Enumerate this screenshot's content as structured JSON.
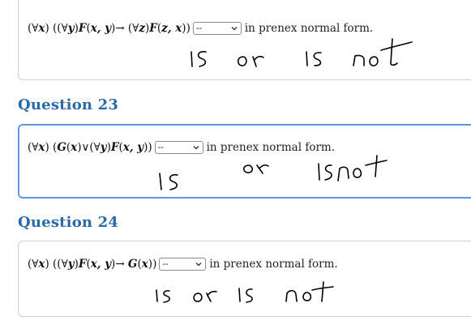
{
  "questions": [
    {
      "heading": "",
      "formula": {
        "part1": "(∀",
        "var1": "x",
        "part2": ") ((∀",
        "var2": "y",
        "part3": ")",
        "pred": "F",
        "part4": "(",
        "args": "x, y",
        "part5": ")→ (∀",
        "var3": "z",
        "part6": ")",
        "pred2": "F",
        "part7": "(",
        "args2": "z, x",
        "part8": "))"
      },
      "select_value": "--",
      "suffix": "in prenex normal form.",
      "handwriting": [
        "is",
        "or",
        "is not"
      ]
    },
    {
      "heading": "Question 23",
      "formula": {
        "part1": "(∀",
        "var1": "x",
        "part2": ") (",
        "pred": "G",
        "part3": "(",
        "args": "x",
        "part4": ")∨(∀",
        "var2": "y",
        "part5": ")",
        "pred2": "F",
        "part6": "(",
        "args2": "x, y",
        "part7": "))"
      },
      "select_value": "--",
      "suffix": "in prenex normal form.",
      "handwriting": [
        "is",
        "or",
        "is not"
      ]
    },
    {
      "heading": "Question 24",
      "formula": {
        "part1": "(∀",
        "var1": "x",
        "part2": ") ((∀",
        "var2": "y",
        "part3": ")",
        "pred": "F",
        "part4": "(",
        "args": "x, y",
        "part5": ")→ ",
        "pred2": "G",
        "part6": "(",
        "args2": "x",
        "part7": "))"
      },
      "select_value": "--",
      "suffix": "in prenex normal form.",
      "handwriting": [
        "is",
        "or",
        "is not"
      ]
    }
  ],
  "colors": {
    "heading": "#2b6aa8",
    "active_border": "#4f8fd6",
    "card_border": "#cfcfcf",
    "ink": "#000000"
  },
  "icons": {
    "select_arrow": "chevron-down-icon"
  }
}
